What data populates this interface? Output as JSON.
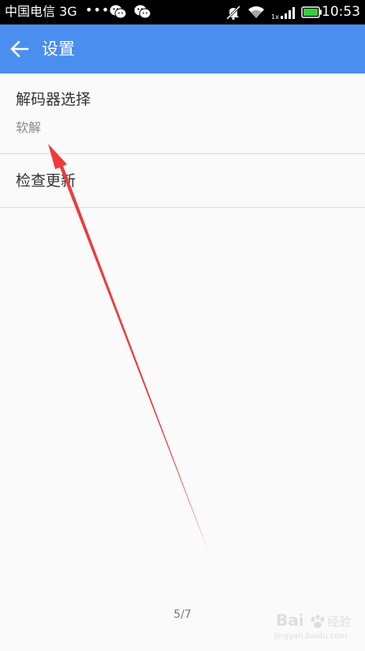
{
  "status_bar": {
    "carrier": "中国电信 3G",
    "dots": "•••",
    "time": "10:53",
    "network_type": "1x"
  },
  "toolbar": {
    "back_icon": "arrow-left-icon",
    "title": "设置",
    "color": "#4a8ef0"
  },
  "settings": [
    {
      "title": "解码器选择",
      "summary": "软解"
    },
    {
      "title": "检查更新"
    }
  ],
  "page_indicator": "5/7",
  "annotation": {
    "color": "#ee3b3b"
  },
  "watermark": {
    "line1": "Baidu 经验",
    "line2": "jingyan.baidu.com"
  }
}
